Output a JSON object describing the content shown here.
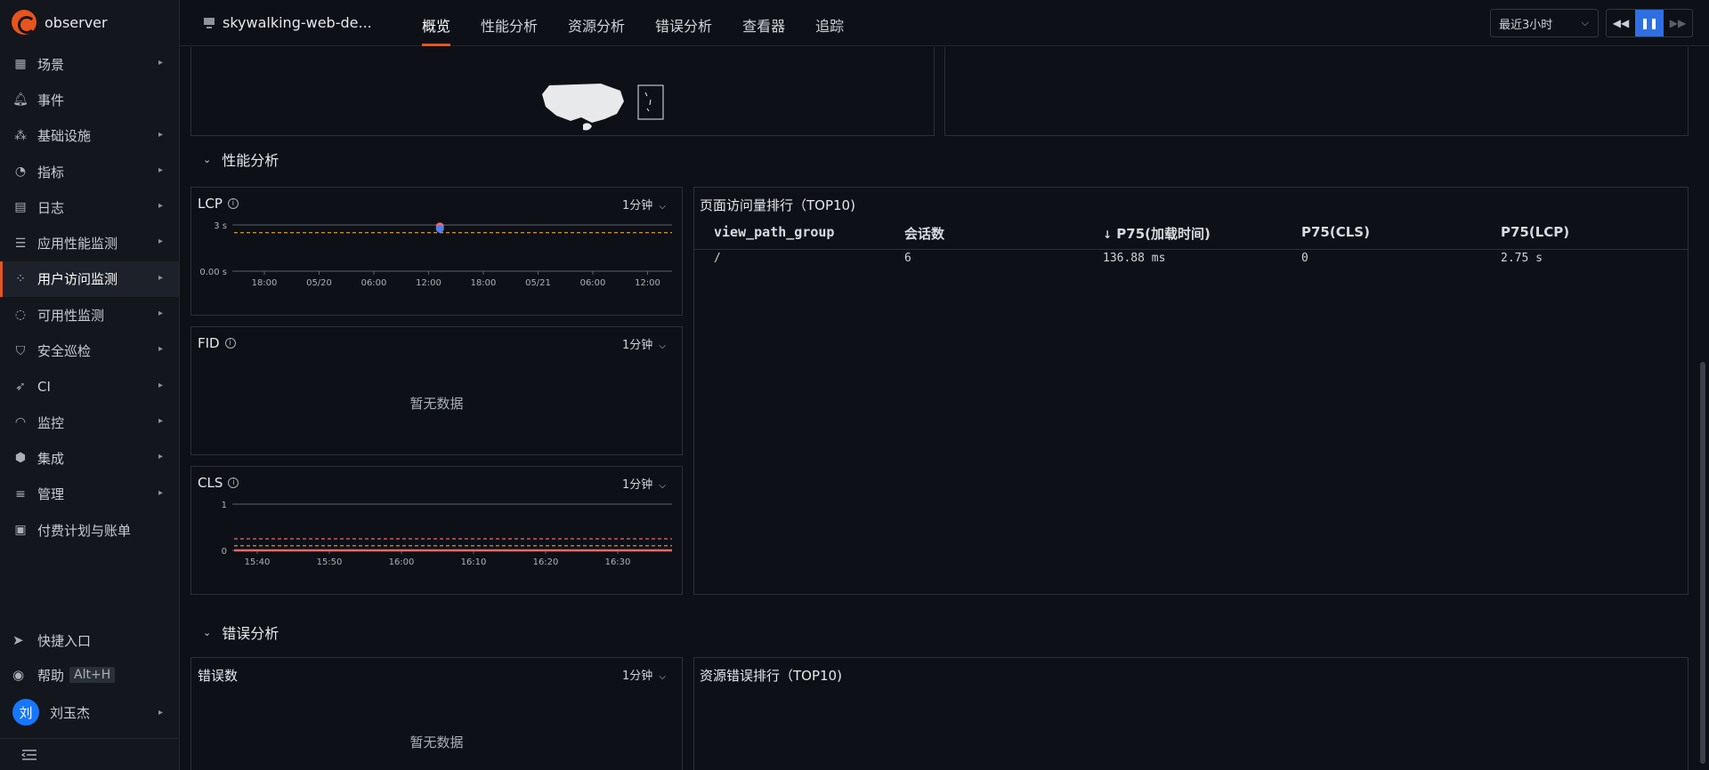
{
  "app": {
    "name": "observer"
  },
  "sidebar": {
    "items": [
      {
        "label": "场景",
        "icon": "dashboard-icon",
        "arrow": true
      },
      {
        "label": "事件",
        "icon": "bell-icon",
        "arrow": false
      },
      {
        "label": "基础设施",
        "icon": "cluster-icon",
        "arrow": true
      },
      {
        "label": "指标",
        "icon": "gauge-icon",
        "arrow": true
      },
      {
        "label": "日志",
        "icon": "calendar-icon",
        "arrow": true
      },
      {
        "label": "应用性能监测",
        "icon": "apm-icon",
        "arrow": true
      },
      {
        "label": "用户访问监测",
        "icon": "rum-icon",
        "arrow": true
      },
      {
        "label": "可用性监测",
        "icon": "satellite-icon",
        "arrow": true
      },
      {
        "label": "安全巡检",
        "icon": "shield-icon",
        "arrow": true
      },
      {
        "label": "CI",
        "icon": "rocket-icon",
        "arrow": true
      },
      {
        "label": "监控",
        "icon": "monitor-icon",
        "arrow": true
      },
      {
        "label": "集成",
        "icon": "cube-icon",
        "arrow": true
      },
      {
        "label": "管理",
        "icon": "sliders-icon",
        "arrow": true
      },
      {
        "label": "付费计划与账单",
        "icon": "billing-icon",
        "arrow": false
      }
    ],
    "active_index": 6,
    "quick_entry": "快捷入口",
    "help": "帮助",
    "help_shortcut": "Alt+H",
    "user_initial": "刘",
    "user_name": "刘玉杰"
  },
  "topbar": {
    "app_name": "skywalking-web-de...",
    "tabs": [
      "概览",
      "性能分析",
      "资源分析",
      "错误分析",
      "查看器",
      "追踪"
    ],
    "active_tab": 0,
    "time_range": "最近3小时"
  },
  "sections": {
    "performance": "性能分析",
    "errors": "错误分析"
  },
  "panels": {
    "lcp": {
      "title": "LCP",
      "interval": "1分钟"
    },
    "fid": {
      "title": "FID",
      "interval": "1分钟",
      "empty": "暂无数据"
    },
    "cls": {
      "title": "CLS",
      "interval": "1分钟"
    },
    "page_rank": {
      "title": "页面访问量排行（TOP10)"
    },
    "error_count": {
      "title": "错误数",
      "interval": "1分钟",
      "empty": "暂无数据"
    },
    "resource_error_rank": {
      "title": "资源错误排行（TOP10)"
    }
  },
  "page_table": {
    "columns": [
      "view_path_group",
      "会话数",
      "P75(加载时间)",
      "P75(CLS)",
      "P75(LCP)"
    ],
    "sort_indicator": "↓",
    "rows": [
      [
        "/",
        "6",
        "136.88 ms",
        "0",
        "2.75 s"
      ]
    ]
  },
  "chart_data": [
    {
      "type": "line",
      "title": "LCP",
      "x": [
        "18:00",
        "05/20",
        "06:00",
        "12:00",
        "18:00",
        "05/21",
        "06:00",
        "12:00"
      ],
      "ylim": [
        0,
        3
      ],
      "y_ticks": [
        "0.00 s",
        "3 s"
      ],
      "series": [
        {
          "name": "",
          "points": [
            {
              "x_frac": 0.47,
              "y": 2.9,
              "color": "#f06a6a"
            },
            {
              "x_frac": 0.47,
              "y": 2.75,
              "color": "#4f7df5"
            }
          ]
        }
      ],
      "reference_lines": [
        {
          "y": 2.5,
          "style": "dashed",
          "color": "#e8a33c"
        }
      ]
    },
    {
      "type": "line",
      "title": "CLS",
      "x": [
        "15:40",
        "15:50",
        "16:00",
        "16:10",
        "16:20",
        "16:30"
      ],
      "ylim": [
        0,
        1
      ],
      "y_ticks": [
        "0",
        "1"
      ],
      "series": [
        {
          "name": "",
          "values_flat": 0,
          "color": "#f06a6a"
        }
      ],
      "reference_lines": [
        {
          "y": 0.25,
          "style": "dashed",
          "color": "#f06a6a"
        },
        {
          "y": 0.1,
          "style": "dashed",
          "color": "#e8a33c"
        }
      ]
    }
  ]
}
